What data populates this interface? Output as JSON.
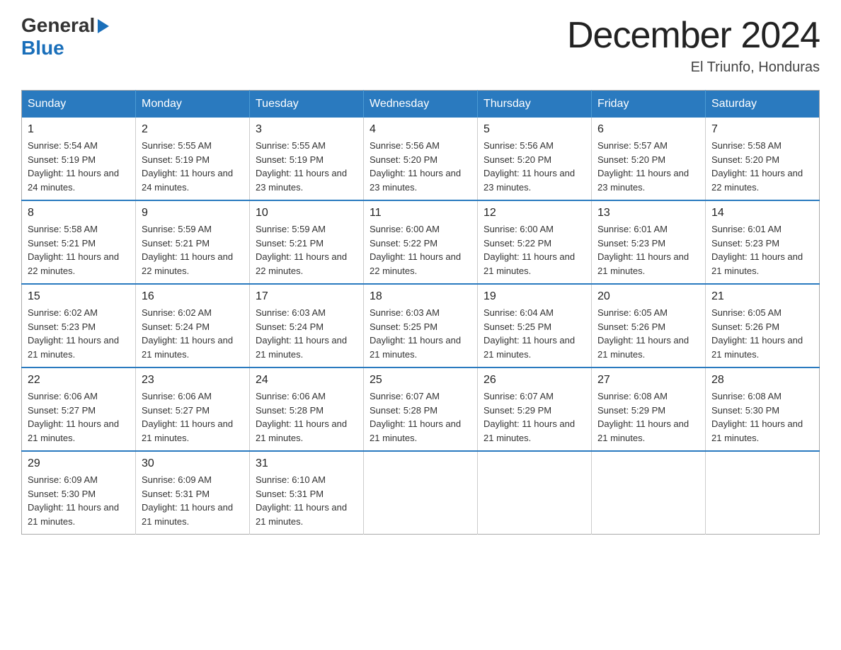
{
  "header": {
    "logo_general": "General",
    "logo_blue": "Blue",
    "month_title": "December 2024",
    "location": "El Triunfo, Honduras"
  },
  "days_of_week": [
    "Sunday",
    "Monday",
    "Tuesday",
    "Wednesday",
    "Thursday",
    "Friday",
    "Saturday"
  ],
  "weeks": [
    [
      {
        "day": "1",
        "sunrise": "5:54 AM",
        "sunset": "5:19 PM",
        "daylight": "11 hours and 24 minutes."
      },
      {
        "day": "2",
        "sunrise": "5:55 AM",
        "sunset": "5:19 PM",
        "daylight": "11 hours and 24 minutes."
      },
      {
        "day": "3",
        "sunrise": "5:55 AM",
        "sunset": "5:19 PM",
        "daylight": "11 hours and 23 minutes."
      },
      {
        "day": "4",
        "sunrise": "5:56 AM",
        "sunset": "5:20 PM",
        "daylight": "11 hours and 23 minutes."
      },
      {
        "day": "5",
        "sunrise": "5:56 AM",
        "sunset": "5:20 PM",
        "daylight": "11 hours and 23 minutes."
      },
      {
        "day": "6",
        "sunrise": "5:57 AM",
        "sunset": "5:20 PM",
        "daylight": "11 hours and 23 minutes."
      },
      {
        "day": "7",
        "sunrise": "5:58 AM",
        "sunset": "5:20 PM",
        "daylight": "11 hours and 22 minutes."
      }
    ],
    [
      {
        "day": "8",
        "sunrise": "5:58 AM",
        "sunset": "5:21 PM",
        "daylight": "11 hours and 22 minutes."
      },
      {
        "day": "9",
        "sunrise": "5:59 AM",
        "sunset": "5:21 PM",
        "daylight": "11 hours and 22 minutes."
      },
      {
        "day": "10",
        "sunrise": "5:59 AM",
        "sunset": "5:21 PM",
        "daylight": "11 hours and 22 minutes."
      },
      {
        "day": "11",
        "sunrise": "6:00 AM",
        "sunset": "5:22 PM",
        "daylight": "11 hours and 22 minutes."
      },
      {
        "day": "12",
        "sunrise": "6:00 AM",
        "sunset": "5:22 PM",
        "daylight": "11 hours and 21 minutes."
      },
      {
        "day": "13",
        "sunrise": "6:01 AM",
        "sunset": "5:23 PM",
        "daylight": "11 hours and 21 minutes."
      },
      {
        "day": "14",
        "sunrise": "6:01 AM",
        "sunset": "5:23 PM",
        "daylight": "11 hours and 21 minutes."
      }
    ],
    [
      {
        "day": "15",
        "sunrise": "6:02 AM",
        "sunset": "5:23 PM",
        "daylight": "11 hours and 21 minutes."
      },
      {
        "day": "16",
        "sunrise": "6:02 AM",
        "sunset": "5:24 PM",
        "daylight": "11 hours and 21 minutes."
      },
      {
        "day": "17",
        "sunrise": "6:03 AM",
        "sunset": "5:24 PM",
        "daylight": "11 hours and 21 minutes."
      },
      {
        "day": "18",
        "sunrise": "6:03 AM",
        "sunset": "5:25 PM",
        "daylight": "11 hours and 21 minutes."
      },
      {
        "day": "19",
        "sunrise": "6:04 AM",
        "sunset": "5:25 PM",
        "daylight": "11 hours and 21 minutes."
      },
      {
        "day": "20",
        "sunrise": "6:05 AM",
        "sunset": "5:26 PM",
        "daylight": "11 hours and 21 minutes."
      },
      {
        "day": "21",
        "sunrise": "6:05 AM",
        "sunset": "5:26 PM",
        "daylight": "11 hours and 21 minutes."
      }
    ],
    [
      {
        "day": "22",
        "sunrise": "6:06 AM",
        "sunset": "5:27 PM",
        "daylight": "11 hours and 21 minutes."
      },
      {
        "day": "23",
        "sunrise": "6:06 AM",
        "sunset": "5:27 PM",
        "daylight": "11 hours and 21 minutes."
      },
      {
        "day": "24",
        "sunrise": "6:06 AM",
        "sunset": "5:28 PM",
        "daylight": "11 hours and 21 minutes."
      },
      {
        "day": "25",
        "sunrise": "6:07 AM",
        "sunset": "5:28 PM",
        "daylight": "11 hours and 21 minutes."
      },
      {
        "day": "26",
        "sunrise": "6:07 AM",
        "sunset": "5:29 PM",
        "daylight": "11 hours and 21 minutes."
      },
      {
        "day": "27",
        "sunrise": "6:08 AM",
        "sunset": "5:29 PM",
        "daylight": "11 hours and 21 minutes."
      },
      {
        "day": "28",
        "sunrise": "6:08 AM",
        "sunset": "5:30 PM",
        "daylight": "11 hours and 21 minutes."
      }
    ],
    [
      {
        "day": "29",
        "sunrise": "6:09 AM",
        "sunset": "5:30 PM",
        "daylight": "11 hours and 21 minutes."
      },
      {
        "day": "30",
        "sunrise": "6:09 AM",
        "sunset": "5:31 PM",
        "daylight": "11 hours and 21 minutes."
      },
      {
        "day": "31",
        "sunrise": "6:10 AM",
        "sunset": "5:31 PM",
        "daylight": "11 hours and 21 minutes."
      },
      null,
      null,
      null,
      null
    ]
  ]
}
